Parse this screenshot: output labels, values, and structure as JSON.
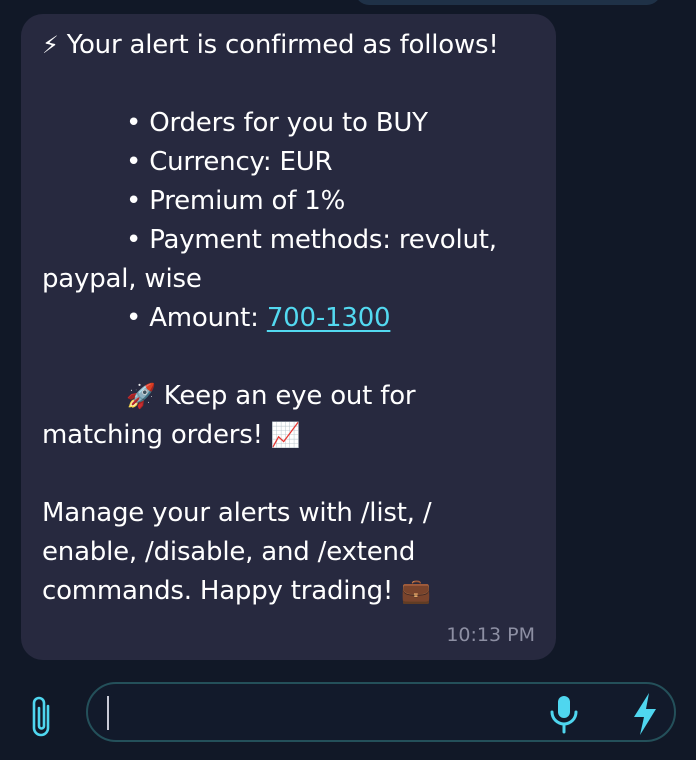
{
  "message": {
    "header_emoji": "⚡",
    "header_text": "Your alert is confirmed as follows!",
    "bullets": {
      "b1": "• Orders for you to BUY",
      "b2": "• Currency: EUR",
      "b3": "• Premium of 1%",
      "b4_line1": "• Payment methods: revolut,",
      "b4_line2": "paypal, wise",
      "b5_prefix": "• Amount: ",
      "b5_link": "700-1300"
    },
    "rocket_emoji": "🚀",
    "keep_line1": "Keep an eye out for",
    "keep_line2": "matching orders!",
    "chart_emoji": "📈",
    "manage_line1": "Manage your alerts with /list, /",
    "manage_line2": "enable, /disable, and /extend",
    "manage_line3": "commands. Happy trading!",
    "briefcase_emoji": "💼",
    "time": "10:13 PM"
  },
  "composer": {
    "placeholder": "",
    "attach_icon": "paperclip-icon",
    "mic_icon": "microphone-icon",
    "bolt_icon": "lightning-icon"
  },
  "colors": {
    "background": "#111827",
    "bubble": "#27293f",
    "link": "#53d9f0",
    "accent": "#4fd6ef",
    "input_border": "#24505a"
  }
}
